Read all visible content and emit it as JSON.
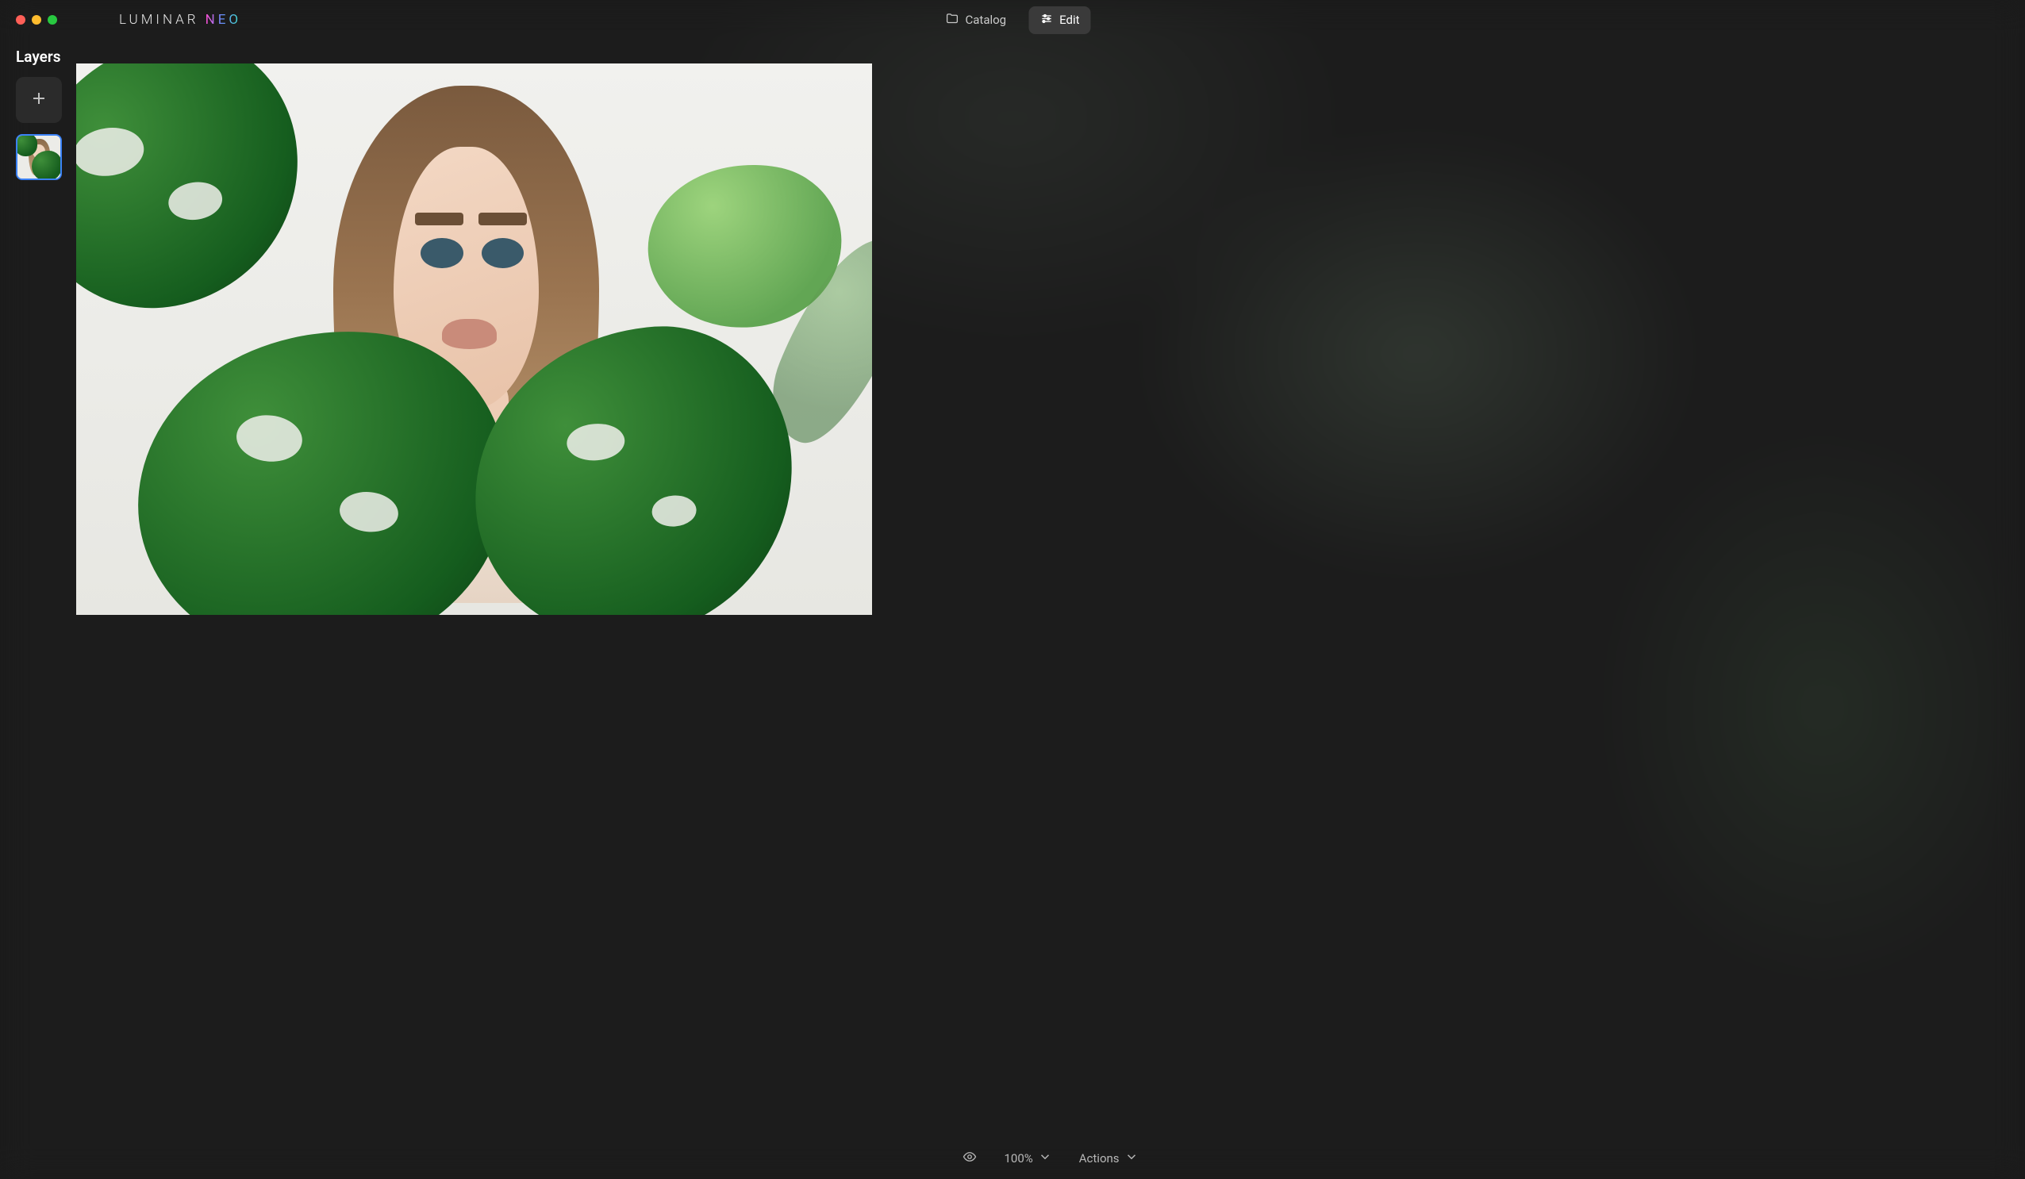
{
  "app": {
    "logo_main": "LUMINAR",
    "logo_neo": "NEO"
  },
  "modes": {
    "catalog": "Catalog",
    "edit": "Edit",
    "active": "edit"
  },
  "layers": {
    "title": "Layers"
  },
  "bottom": {
    "zoom": "100%",
    "actions": "Actions"
  }
}
